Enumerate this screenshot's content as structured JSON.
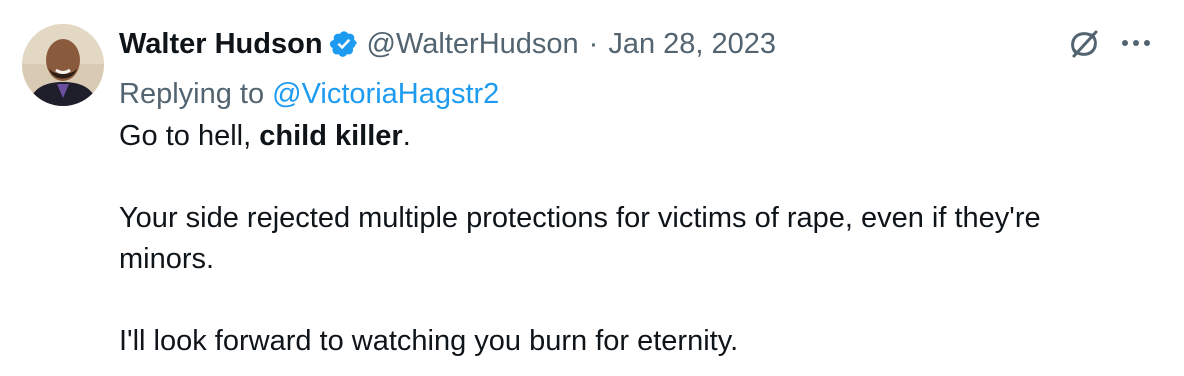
{
  "tweet": {
    "author": {
      "display_name": "Walter Hudson",
      "handle": "@WalterHudson",
      "verified": true
    },
    "separator": "·",
    "date": "Jan 28, 2023",
    "reply": {
      "prefix": "Replying to ",
      "to_handle": "@VictoriaHagstr2"
    },
    "body": {
      "line1_prefix": "Go to hell, ",
      "line1_bold": "child killer",
      "line1_suffix": ".",
      "para2": "Your side rejected multiple protections for victims of rape, even if they're minors.",
      "para3": "I'll look forward to watching you burn for eternity."
    },
    "icons": {
      "verified": "verified-badge-icon",
      "grok": "grok-icon",
      "more": "more-options-icon"
    },
    "colors": {
      "text": "#0f1419",
      "secondary": "#536471",
      "link": "#1d9bf0",
      "verified": "#1d9bf0"
    }
  }
}
